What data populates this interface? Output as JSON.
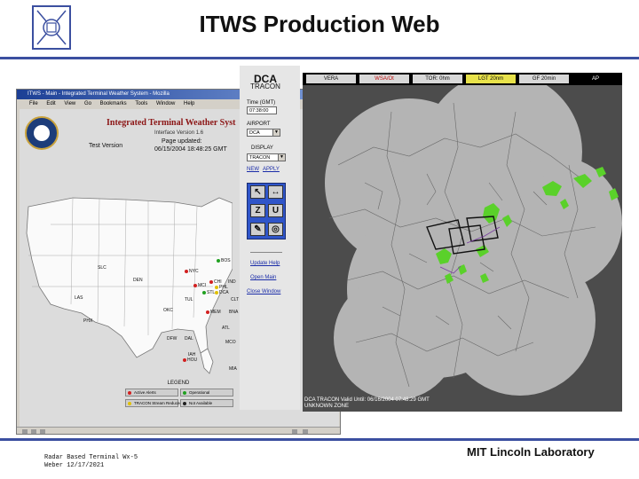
{
  "slide": {
    "title": "ITWS Production Web",
    "footer_left_line1": "Radar Based Terminal Wx-5",
    "footer_left_line2": "Weber 12/17/2021",
    "footer_right": "MIT Lincoln Laboratory",
    "rule_color": "#3b4fa0"
  },
  "browser": {
    "window_title": "ITWS - Main - Integrated Terminal Weather System - Mozilla",
    "window_buttons": [
      "_",
      "□",
      "×"
    ],
    "menu": [
      "File",
      "Edit",
      "View",
      "Go",
      "Bookmarks",
      "Tools",
      "Window",
      "Help"
    ],
    "page": {
      "app_title": "Integrated Terminal Weather Syst",
      "interface_version": "Interface Version 1.6",
      "test_version": "Test Version",
      "page_updated_label": "Page updated:",
      "page_updated_value": "06/15/2004 18:48:25 GMT"
    },
    "airports": [
      {
        "code": "NYC",
        "status": "red"
      },
      {
        "code": "BOS",
        "status": "green"
      },
      {
        "code": "CHI",
        "status": "red"
      },
      {
        "code": "PHL",
        "status": "yellow"
      },
      {
        "code": "DCA",
        "status": "yellow"
      },
      {
        "code": "SLC",
        "status": "none"
      },
      {
        "code": "DEN",
        "status": "none"
      },
      {
        "code": "MCI",
        "status": "red"
      },
      {
        "code": "STL",
        "status": "green"
      },
      {
        "code": "IND",
        "status": "none"
      },
      {
        "code": "LAS",
        "status": "none"
      },
      {
        "code": "PHX",
        "status": "none"
      },
      {
        "code": "OKC",
        "status": "none"
      },
      {
        "code": "CLT",
        "status": "none"
      },
      {
        "code": "TUL",
        "status": "none"
      },
      {
        "code": "MEM",
        "status": "red"
      },
      {
        "code": "BNA",
        "status": "none"
      },
      {
        "code": "ATL",
        "status": "none"
      },
      {
        "code": "DFW",
        "status": "none"
      },
      {
        "code": "DAL",
        "status": "none"
      },
      {
        "code": "MCO",
        "status": "none"
      },
      {
        "code": "IAH",
        "status": "none"
      },
      {
        "code": "HOU",
        "status": "red"
      },
      {
        "code": "MIA",
        "status": "none"
      }
    ],
    "legend": {
      "title": "LEGEND",
      "items": [
        {
          "label": "Active Alerts",
          "color": "#d22020"
        },
        {
          "label": "Operational",
          "color": "#20a020"
        },
        {
          "label": "TRACON Stream Reduced",
          "color": "#e0c000"
        },
        {
          "label": "Not Available",
          "color": "#202020"
        }
      ]
    }
  },
  "itws": {
    "airport_code": "DCA",
    "tracon_label": "TRACON",
    "time_label": "Time (GMT)",
    "time_value": "07:38:00",
    "airport_label": "AIRPORT",
    "airport_value": "DCA",
    "display_label": "DISPLAY",
    "display_value": "TRACON",
    "new_link": "NEW",
    "apply_link": "APPLY",
    "tools": [
      "↖",
      "↔",
      "Z",
      "U",
      "✎",
      "◎"
    ],
    "update_help": "Update Help",
    "open_main": "Open Main",
    "close_window": "Close Window",
    "product_tabs": [
      {
        "label": "VERA",
        "color": "#111111"
      },
      {
        "label": "WSA/Ot",
        "color": "#c01010"
      },
      {
        "label": "TOR: 0hm",
        "color": "#111111"
      },
      {
        "label": "LGT 20nm",
        "color": "#111111"
      },
      {
        "label": "GF 20min",
        "color": "#111111"
      },
      {
        "label": "AP",
        "color": "#ffffff"
      }
    ],
    "radar_status": "DCA TRACON  Valid Until: 06/16/2004 07:48:29 GMT",
    "radar_status_line2": "UNKNOWN ZONE",
    "colors": {
      "coverage": "#b4b4b4",
      "background": "#4c4c4c",
      "precip": "#5ad12a"
    }
  }
}
